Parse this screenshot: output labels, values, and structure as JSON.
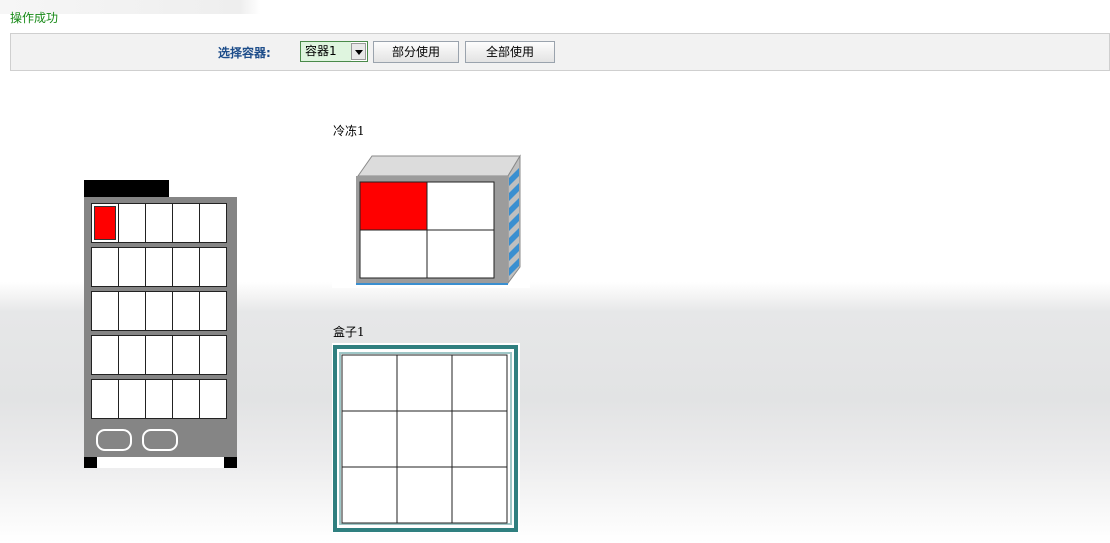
{
  "status": {
    "message": "操作成功",
    "color": "#178a17"
  },
  "toolbar": {
    "label": "选择容器:",
    "container_select": {
      "selected": "容器1"
    },
    "partial_use_label": "部分使用",
    "full_use_label": "全部使用"
  },
  "cabinet": {
    "rows": 5,
    "cols": 5,
    "used_cells": [
      [
        0,
        0
      ]
    ]
  },
  "freezer": {
    "name": "冷冻1",
    "rows": 2,
    "cols": 2,
    "used_cells": [
      [
        0,
        0
      ]
    ]
  },
  "box": {
    "name": "盒子1",
    "rows": 3,
    "cols": 3,
    "used_cells": []
  },
  "colors": {
    "used": "#ff0000",
    "cabinet_body": "#858585",
    "freezer_stripe": "#3a8fd0",
    "box_frame": "#2f7f7f"
  }
}
